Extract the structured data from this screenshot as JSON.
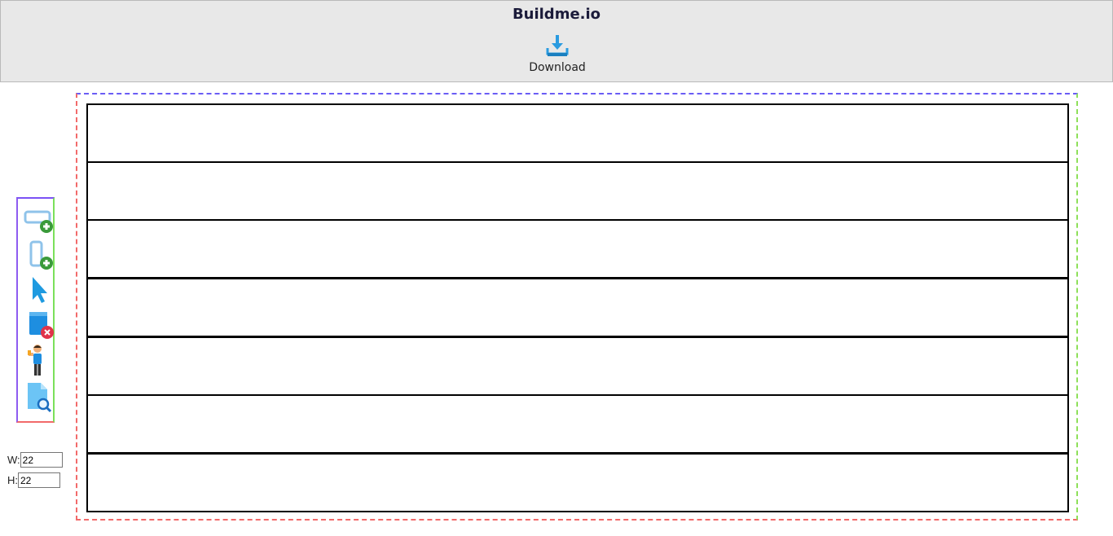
{
  "header": {
    "title": "Buildme.io",
    "download_label": "Download",
    "download_icon": "download-icon"
  },
  "toolbar": {
    "tools": [
      {
        "name": "add-row-tool",
        "icon": "add-horizontal-box-icon"
      },
      {
        "name": "add-column-tool",
        "icon": "add-vertical-box-icon"
      },
      {
        "name": "select-tool",
        "icon": "cursor-arrow-icon"
      },
      {
        "name": "delete-tool",
        "icon": "delete-block-icon"
      },
      {
        "name": "person-tool",
        "icon": "person-icon"
      },
      {
        "name": "preview-tool",
        "icon": "document-search-icon"
      }
    ]
  },
  "dimensions": {
    "width_label": "W:",
    "width_value": "22",
    "height_label": "H:",
    "height_value": "22"
  },
  "canvas": {
    "row_count": 7
  },
  "colors": {
    "header_bg": "#e8e8e8",
    "accent_blue": "#2a9be0",
    "plus_green": "#3a9a3a",
    "delete_red": "#e0334a"
  }
}
